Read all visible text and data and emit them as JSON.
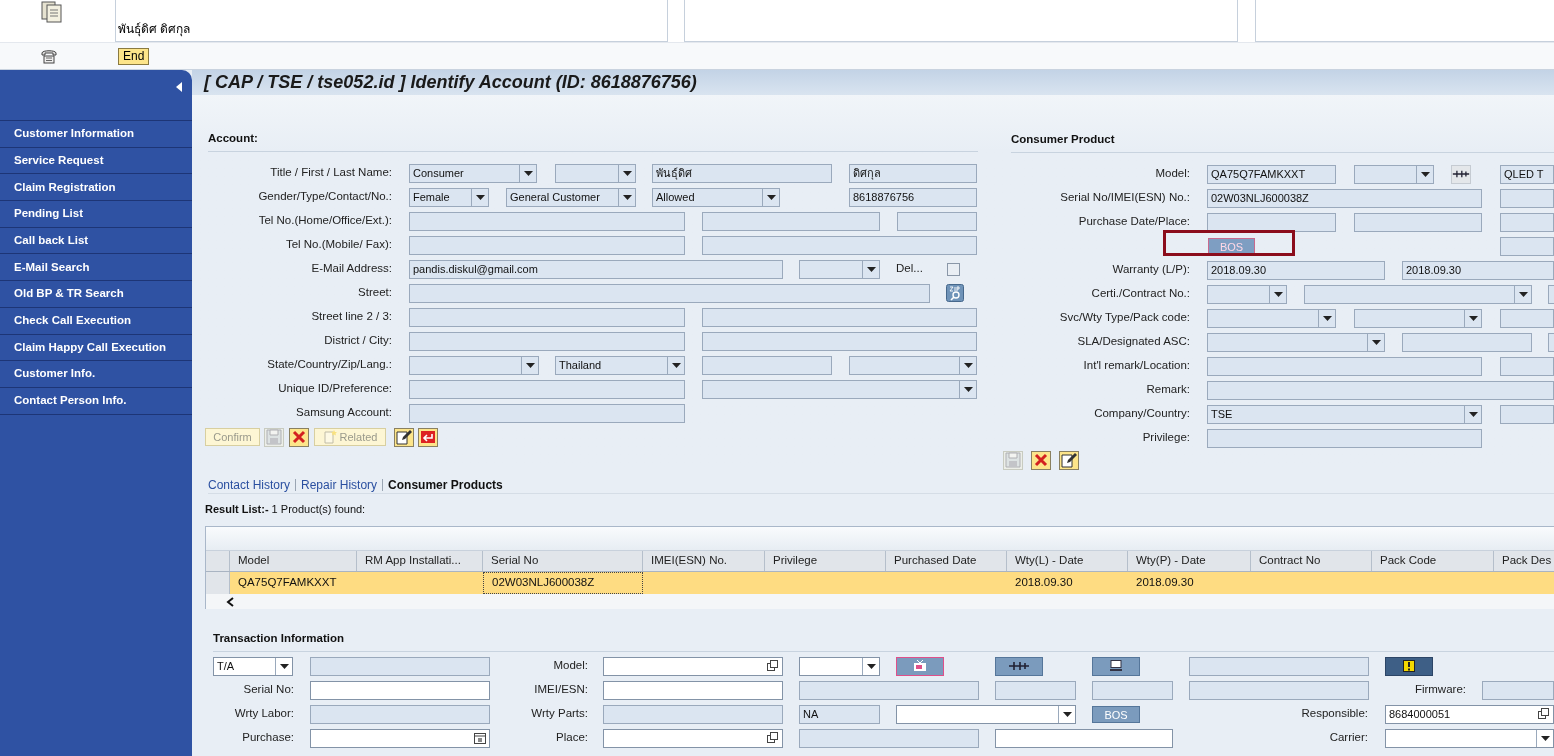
{
  "header": {
    "contact_name": "พันธุ์ดิศ ดิศกุล",
    "end_button": "End"
  },
  "title": "[ CAP / TSE / tse052.id ] Identify Account (ID: 8618876756)",
  "sidebar": {
    "items": [
      {
        "label": "Customer Information",
        "selected": false
      },
      {
        "label": "Service Request",
        "selected": false
      },
      {
        "label": "Claim Registration",
        "selected": false
      },
      {
        "label": "Pending List",
        "selected": false
      },
      {
        "label": "Call back List",
        "selected": false
      },
      {
        "label": "E-Mail Search",
        "selected": false
      },
      {
        "label": "Old BP & TR Search",
        "selected": false
      },
      {
        "label": "Check Call Execution",
        "selected": false
      },
      {
        "label": "Claim Happy Call Execution",
        "selected": false
      },
      {
        "label": "Customer Info.",
        "selected": false
      },
      {
        "label": "Contact Person Info.",
        "selected": false
      }
    ]
  },
  "account": {
    "title": "Account:",
    "rows": [
      {
        "label": "Title / First / Last Name:",
        "items": [
          {
            "kind": "dropdown",
            "value": "Consumer"
          },
          {
            "kind": "dropdown"
          },
          {
            "kind": "input",
            "value": "พันธุ์ดิศ"
          },
          {
            "kind": "input",
            "value": "ดิศกุล"
          }
        ]
      },
      {
        "label": "Gender/Type/Contact/No.:",
        "items": [
          {
            "kind": "dropdown",
            "value": "Female"
          },
          {
            "kind": "dropdown",
            "value": "General Customer"
          },
          {
            "kind": "dropdown",
            "value": "Allowed"
          },
          {
            "kind": "input",
            "value": "8618876756"
          }
        ]
      },
      {
        "label": "Tel No.(Home/Office/Ext.):",
        "items": [
          {
            "kind": "input"
          },
          {
            "kind": "input"
          },
          {
            "kind": "input"
          }
        ]
      },
      {
        "label": "Tel No.(Mobile/ Fax):",
        "items": [
          {
            "kind": "input"
          },
          {
            "kind": "input"
          }
        ]
      },
      {
        "label": "E-Mail Address:",
        "items": [
          {
            "kind": "input",
            "value": "pandis.diskul@gmail.com"
          },
          {
            "kind": "dropdown"
          },
          {
            "kind": "text",
            "value": "Del..."
          },
          {
            "kind": "checkbox",
            "checked": false
          }
        ]
      },
      {
        "label": "Street:",
        "items": [
          {
            "kind": "input"
          },
          {
            "kind": "icon_button"
          }
        ]
      },
      {
        "label": "Street line 2 / 3:",
        "items": [
          {
            "kind": "input"
          },
          {
            "kind": "input"
          }
        ]
      },
      {
        "label": "District / City:",
        "items": [
          {
            "kind": "input"
          },
          {
            "kind": "input"
          }
        ]
      },
      {
        "label": "State/Country/Zip/Lang.:",
        "items": [
          {
            "kind": "dropdown"
          },
          {
            "kind": "dropdown",
            "value": "Thailand"
          },
          {
            "kind": "input"
          },
          {
            "kind": "dropdown"
          }
        ]
      },
      {
        "label": "Unique ID/Preference:",
        "items": [
          {
            "kind": "input"
          },
          {
            "kind": "dropdown"
          }
        ]
      },
      {
        "label": "Samsung Account:",
        "items": [
          {
            "kind": "input"
          }
        ]
      }
    ],
    "toolbar": [
      {
        "kind": "text_button",
        "label": "Confirm",
        "disabled": true
      },
      {
        "kind": "icon_button",
        "disabled": true
      },
      {
        "kind": "icon_button",
        "disabled": false
      },
      {
        "kind": "text_button",
        "label": "Related",
        "disabled": true
      },
      {
        "kind": "icon_button",
        "disabled": false
      },
      {
        "kind": "icon_button",
        "disabled": false
      }
    ]
  },
  "consumer_product": {
    "title": "Consumer Product",
    "rows": [
      {
        "label": "Model:",
        "items": [
          {
            "kind": "input",
            "value": "QA75Q7FAMKXXT"
          },
          {
            "kind": "dropdown"
          },
          {
            "kind": "icon_button"
          },
          {
            "kind": "input",
            "value": "QLED T"
          }
        ]
      },
      {
        "label": "Serial No/IMEI(ESN) No.:",
        "items": [
          {
            "kind": "input",
            "value": "02W03NLJ600038Z"
          },
          {
            "kind": "input"
          }
        ]
      },
      {
        "label": "Purchase Date/Place:",
        "items": [
          {
            "kind": "input"
          },
          {
            "kind": "input"
          },
          {
            "kind": "input"
          }
        ]
      },
      {
        "items": [
          {
            "kind": "button",
            "label": "BOS",
            "outlined": true
          },
          {
            "kind": "input"
          }
        ]
      },
      {
        "label": "Warranty (L/P):",
        "items": [
          {
            "kind": "input",
            "value": "2018.09.30"
          },
          {
            "kind": "input",
            "value": "2018.09.30"
          }
        ]
      },
      {
        "label": "Certi./Contract No.:",
        "items": [
          {
            "kind": "dropdown"
          },
          {
            "kind": "dropdown"
          },
          {
            "kind": "input"
          }
        ]
      },
      {
        "label": "Svc/Wty Type/Pack code:",
        "items": [
          {
            "kind": "dropdown"
          },
          {
            "kind": "dropdown"
          },
          {
            "kind": "input"
          }
        ]
      },
      {
        "label": "SLA/Designated ASC:",
        "items": [
          {
            "kind": "dropdown"
          },
          {
            "kind": "input"
          },
          {
            "kind": "input"
          }
        ]
      },
      {
        "label": "Int'l remark/Location:",
        "items": [
          {
            "kind": "input"
          },
          {
            "kind": "input"
          }
        ]
      },
      {
        "label": "Remark:",
        "items": [
          {
            "kind": "input"
          }
        ]
      },
      {
        "label": "Company/Country:",
        "items": [
          {
            "kind": "dropdown",
            "value": "TSE"
          },
          {
            "kind": "input"
          }
        ]
      },
      {
        "label": "Privilege:",
        "items": [
          {
            "kind": "input"
          }
        ]
      }
    ],
    "toolbar": [
      {
        "kind": "icon_button",
        "disabled": true
      },
      {
        "kind": "icon_button",
        "disabled": false
      },
      {
        "kind": "icon_button",
        "disabled": false
      }
    ]
  },
  "tabs": [
    {
      "label": "Contact History",
      "selected": false
    },
    {
      "label": "Repair History",
      "selected": false
    },
    {
      "label": "Consumer Products",
      "selected": true
    }
  ],
  "result_summary": "**Result List:-** 1 Product(s) found:",
  "table": {
    "columns": [
      "Model",
      "RM App Installati...",
      "Serial No",
      "IMEI(ESN) No.",
      "Privilege",
      "Purchased Date",
      "Wty(L) - Date",
      "Wty(P) - Date",
      "Contract No",
      "Pack Code",
      "Pack Des"
    ],
    "rows": [
      {
        "selected": true,
        "cells": [
          {
            "text": "QA75Q7FAMKXXT",
            "focused": false
          },
          {
            "focused": false
          },
          {
            "text": "02W03NLJ600038Z",
            "focused": true
          },
          {
            "focused": false
          },
          {
            "focused": false
          },
          {
            "focused": false
          },
          {
            "text": "2018.09.30",
            "focused": false
          },
          {
            "text": "2018.09.30",
            "focused": false
          },
          {
            "focused": false
          },
          {
            "focused": false
          },
          {
            "focused": false
          }
        ]
      }
    ]
  },
  "transaction": {
    "title": "Transaction Information",
    "rows": [
      {
        "items": [
          {
            "kind": "dropdown",
            "value": "T/A",
            "disabled": false
          },
          {
            "kind": "input",
            "disabled": true
          },
          {
            "kind": "label",
            "value": "Model:"
          },
          {
            "kind": "lookup",
            "disabled": false
          },
          {
            "kind": "dropdown",
            "disabled": false
          },
          {
            "kind": "icon_button"
          },
          {
            "kind": "icon_button"
          },
          {
            "kind": "icon_button"
          },
          {
            "kind": "input",
            "disabled": true
          },
          {
            "kind": "icon_button"
          }
        ]
      },
      {
        "items": [
          {
            "kind": "label",
            "value": "Serial No:"
          },
          {
            "kind": "input",
            "disabled": false
          },
          {
            "kind": "label",
            "value": "IMEI/ESN:"
          },
          {
            "kind": "input",
            "disabled": false
          },
          {
            "kind": "input",
            "disabled": true
          },
          {
            "kind": "input",
            "disabled": true
          },
          {
            "kind": "input",
            "disabled": true
          },
          {
            "kind": "input",
            "disabled": true
          },
          {
            "kind": "label",
            "value": "Firmware:"
          },
          {
            "kind": "input",
            "disabled": true
          }
        ]
      },
      {
        "items": [
          {
            "kind": "label",
            "value": "Wrty Labor:"
          },
          {
            "kind": "input",
            "disabled": true
          },
          {
            "kind": "label",
            "value": "Wrty Parts:"
          },
          {
            "kind": "input",
            "disabled": true
          },
          {
            "kind": "input",
            "value": "NA",
            "disabled": true
          },
          {
            "kind": "dropdown",
            "disabled": false
          },
          {
            "kind": "button",
            "label": "BOS",
            "outlined": false
          },
          {
            "kind": "label",
            "value": "Responsible:"
          },
          {
            "kind": "lookup",
            "value": "8684000051",
            "disabled": false
          }
        ]
      },
      {
        "items": [
          {
            "kind": "label",
            "value": "Purchase:"
          },
          {
            "kind": "date",
            "disabled": false
          },
          {
            "kind": "label",
            "value": "Place:"
          },
          {
            "kind": "lookup",
            "disabled": false
          },
          {
            "kind": "input",
            "disabled": true
          },
          {
            "kind": "input",
            "disabled": false
          },
          {
            "kind": "label",
            "value": "Carrier:"
          },
          {
            "kind": "dropdown",
            "disabled": false
          }
        ]
      }
    ]
  }
}
